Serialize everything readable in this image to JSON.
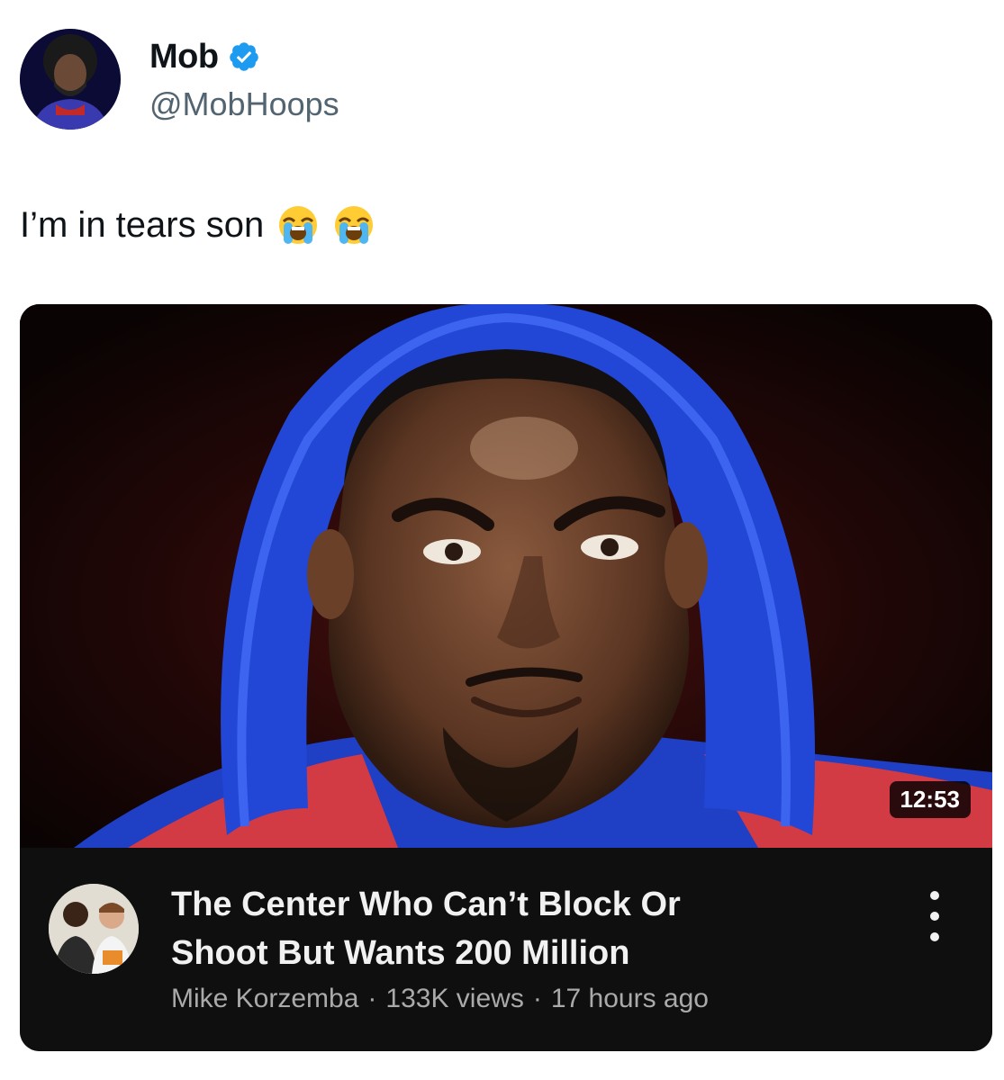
{
  "tweet": {
    "author": {
      "display_name": "Mob",
      "handle": "@MobHoops",
      "verified": true,
      "avatar_icon": "profile-avatar"
    },
    "text": "I’m in tears son",
    "emojis": [
      "loudly-crying-face",
      "loudly-crying-face"
    ]
  },
  "video_card": {
    "duration": "12:53",
    "title_lines": [
      "The Center Who Can’t Block Or",
      "Shoot But Wants 200 Million"
    ],
    "channel": "Mike Korzemba",
    "views": "133K views",
    "age": "17 hours ago",
    "separator": "·",
    "menu_icon": "more-vertical-icon"
  },
  "colors": {
    "verified_blue": "#1d9bf0",
    "handle_gray": "#536471",
    "card_bg": "#0f0f0f",
    "meta_gray": "#aaaaaa",
    "hood_blue": "#1f3fc4"
  }
}
